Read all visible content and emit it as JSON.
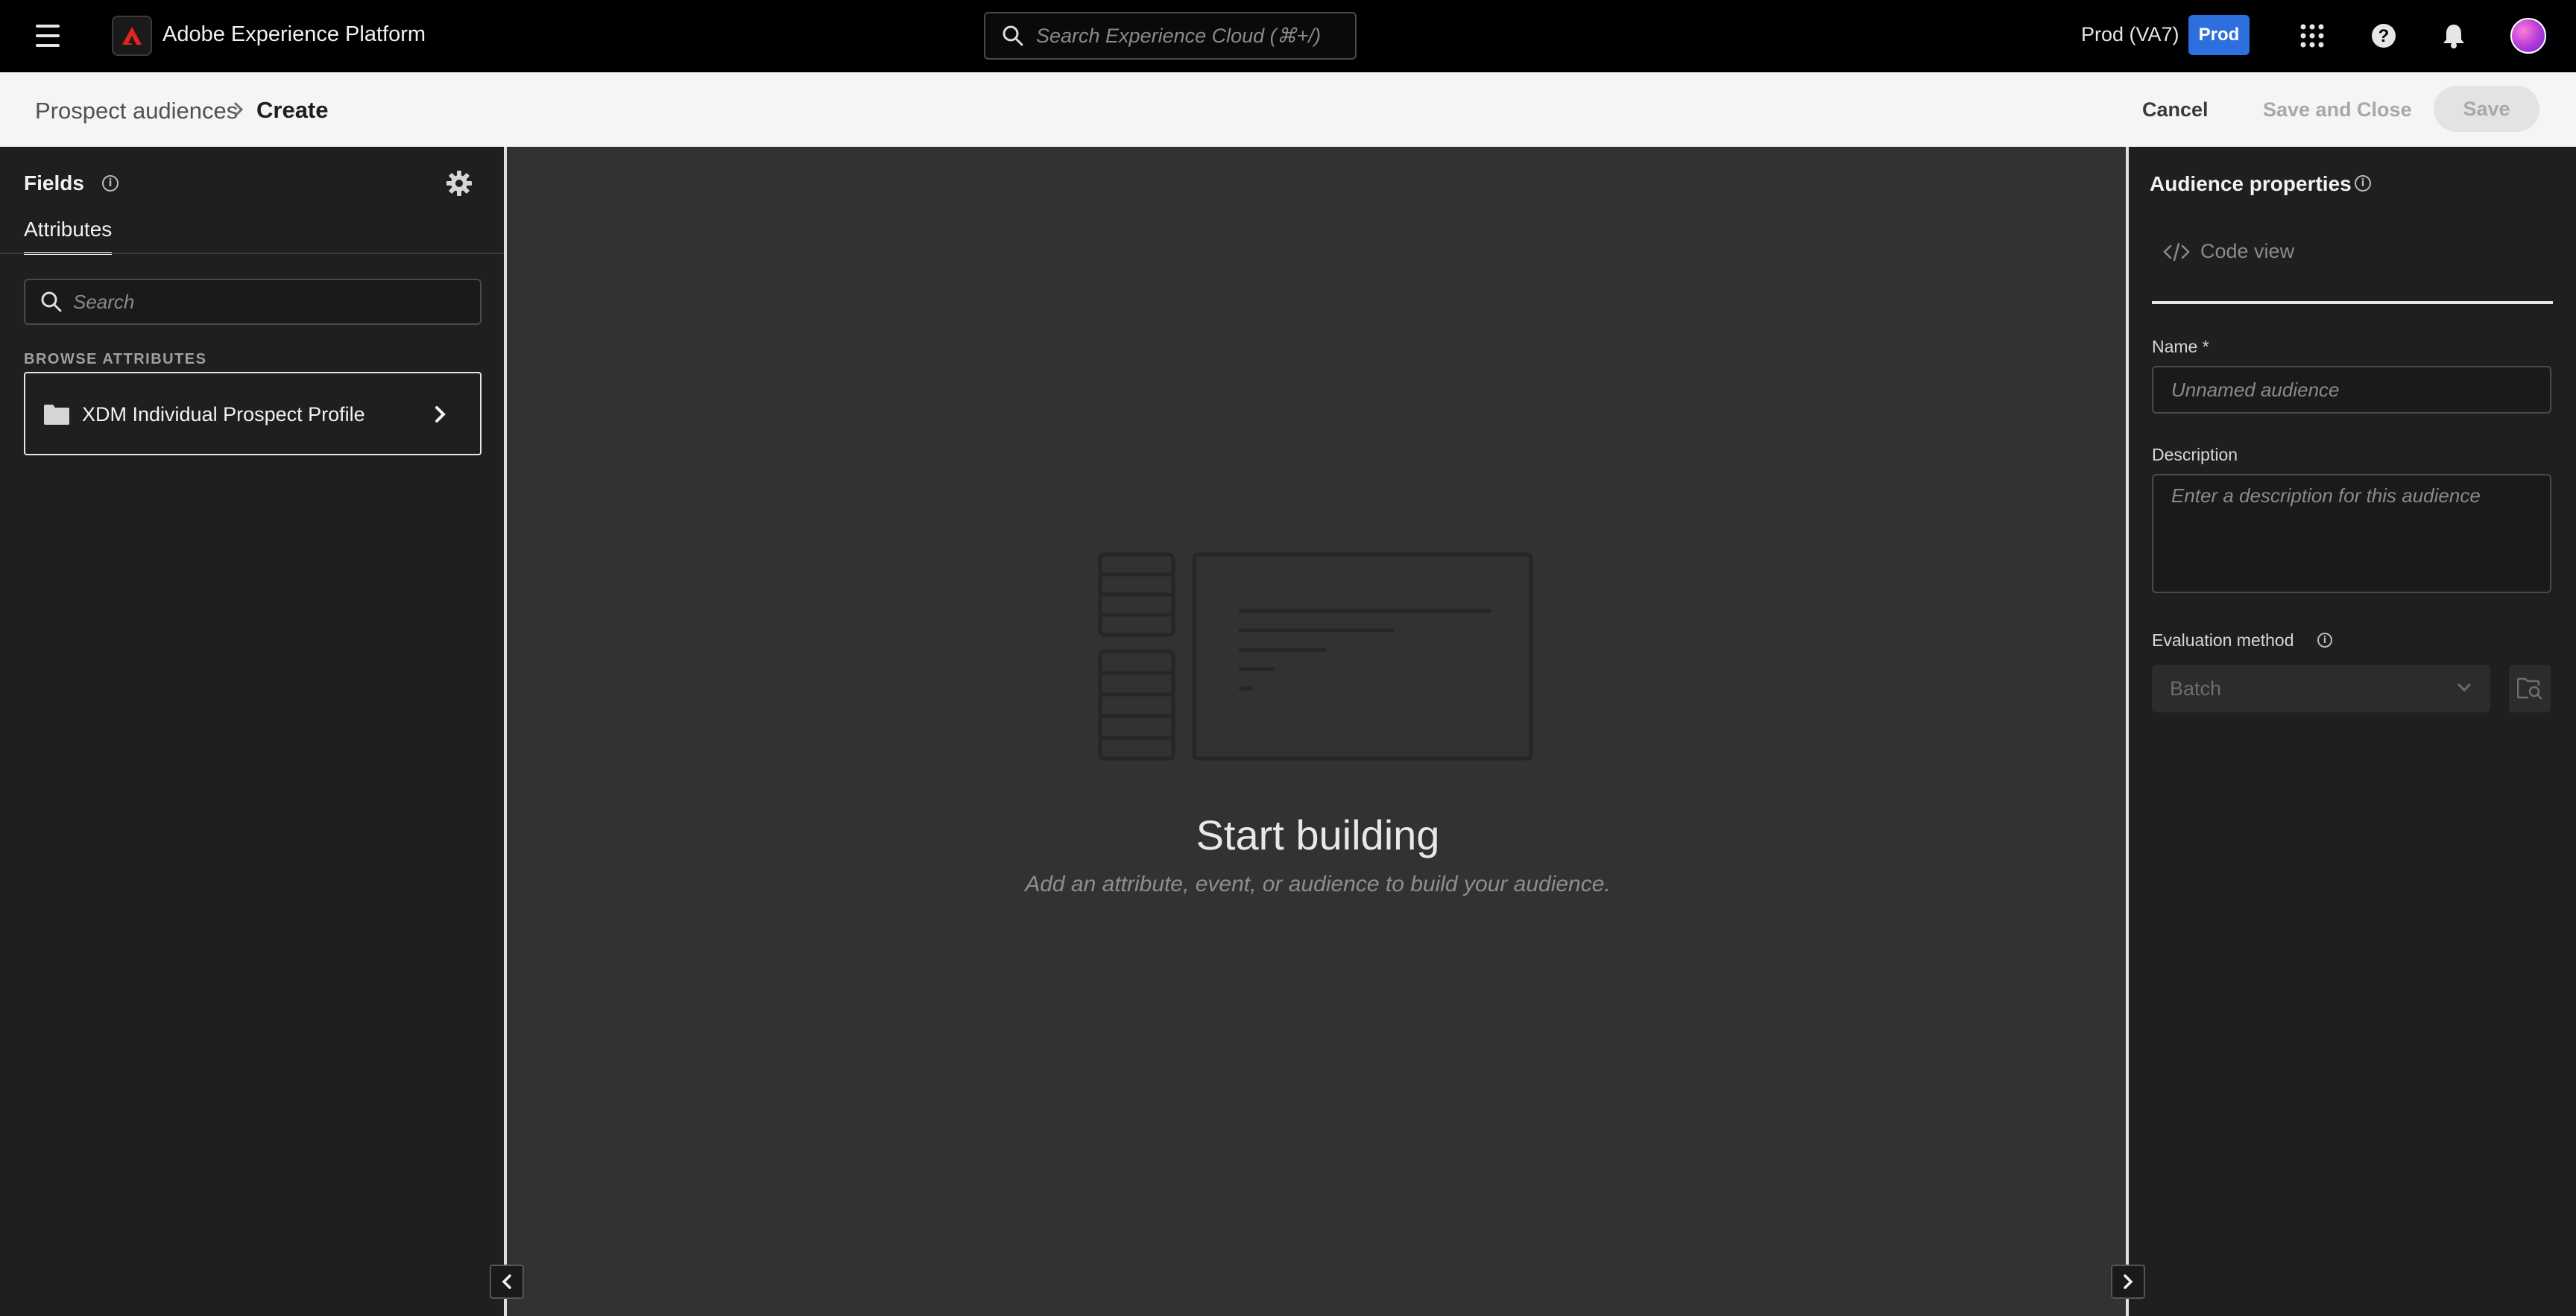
{
  "topbar": {
    "app_title": "Adobe Experience Platform",
    "search_placeholder": "Search Experience Cloud (⌘+/)",
    "sandbox_name": "Prod (VA7)",
    "sandbox_badge": "Prod",
    "icons": [
      "menu-icon",
      "adobe-logo-icon",
      "search-icon",
      "apps-grid-icon",
      "help-icon",
      "notifications-bell-icon",
      "user-avatar"
    ],
    "brand_color": "#e1251b",
    "badge_color": "#2d6fdc"
  },
  "header": {
    "breadcrumb_parent": "Prospect audiences",
    "breadcrumb_current": "Create",
    "cancel_label": "Cancel",
    "save_close_label": "Save and Close",
    "save_label": "Save"
  },
  "fields_panel": {
    "title": "Fields",
    "tab_attributes": "Attributes",
    "search_placeholder": "Search",
    "browse_heading": "BROWSE ATTRIBUTES",
    "items": [
      {
        "label": "XDM Individual Prospect Profile",
        "icon": "folder-icon"
      }
    ]
  },
  "canvas": {
    "empty_title": "Start building",
    "empty_subtitle": "Add an attribute, event, or audience to build your audience."
  },
  "properties_panel": {
    "title": "Audience properties",
    "code_view_label": "Code view",
    "name_label": "Name *",
    "name_placeholder": "Unnamed audience",
    "description_label": "Description",
    "description_placeholder": "Enter a description for this audience",
    "evaluation_label": "Evaluation method",
    "evaluation_value": "Batch"
  }
}
